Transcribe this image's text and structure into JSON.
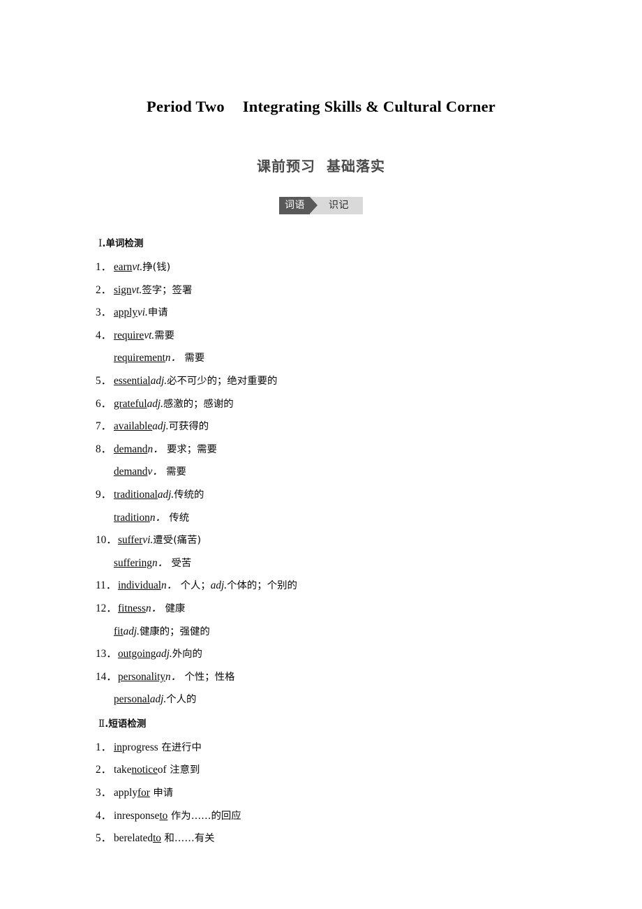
{
  "title": {
    "period": "Period Two",
    "heading": "Integrating Skills & Cultural Corner"
  },
  "subtitle": {
    "left": "课前预习",
    "right": "基础落实"
  },
  "badge": {
    "left_label": "词语",
    "right_label": "识记",
    "arrow_icon": "triangle-right-icon",
    "dark_color": "#595959",
    "light_color": "#d9d9d9"
  },
  "sections": [
    {
      "heading_roman": "Ⅰ",
      "heading_text": ".单词检测",
      "entries": [
        {
          "num": "1．",
          "word": "earn",
          "pos": "vt.",
          "meaning": "挣(钱)"
        },
        {
          "num": "2．",
          "word": "sign",
          "pos": "vt.",
          "meaning": "签字；签署"
        },
        {
          "num": "3．",
          "word": "apply",
          "pos": "vi.",
          "meaning": "申请"
        },
        {
          "num": "4．",
          "word": "require",
          "pos": "vt.",
          "meaning": "需要"
        },
        {
          "num": "",
          "word": "requirement",
          "pos": "n．",
          "meaning": " 需要",
          "sub": true
        },
        {
          "num": "5．",
          "word": "essential",
          "pos": "adj.",
          "meaning": "必不可少的；绝对重要的"
        },
        {
          "num": "6．",
          "word": "grateful",
          "pos": "adj.",
          "meaning": "感激的；感谢的"
        },
        {
          "num": "7．",
          "word": "available",
          "pos": "adj.",
          "meaning": "可获得的"
        },
        {
          "num": "8．",
          "word": "demand",
          "pos": "n．",
          "meaning": " 要求；需要"
        },
        {
          "num": "",
          "word": "demand",
          "pos": "v．",
          "meaning": " 需要",
          "sub": true
        },
        {
          "num": "9．",
          "word": "traditional",
          "pos": "adj.",
          "meaning": "传统的"
        },
        {
          "num": "",
          "word": "tradition",
          "pos": "n．",
          "meaning": " 传统",
          "sub": true
        },
        {
          "num": "10．",
          "word": "suffer",
          "pos": "vi.",
          "meaning": "遭受(痛苦)",
          "wide": true
        },
        {
          "num": "",
          "word": "suffering",
          "pos": "n．",
          "meaning": " 受苦",
          "sub": true
        },
        {
          "num": "11．",
          "word": "individual",
          "pos": "n．",
          "meaning": " 个人；",
          "pos2": "adj.",
          "meaning2": "个体的；个别的",
          "wide": true
        },
        {
          "num": "12．",
          "word": "fitness",
          "pos": "n．",
          "meaning": " 健康",
          "wide": true
        },
        {
          "num": "",
          "word": "fit",
          "pos": "adj.",
          "meaning": "健康的；强健的",
          "sub": true
        },
        {
          "num": "13．",
          "word": "outgoing",
          "pos": "adj.",
          "meaning": "外向的",
          "wide": true
        },
        {
          "num": "14．",
          "word": "personality",
          "pos": "n．",
          "meaning": " 个性；性格",
          "wide": true
        },
        {
          "num": "",
          "word": "personal",
          "pos": "adj.",
          "meaning": "个人的",
          "sub": true
        }
      ]
    },
    {
      "heading_roman": "Ⅱ",
      "heading_text": ".短语检测",
      "phrases": [
        {
          "num": "1．",
          "pre": "",
          "underlined": "in",
          "post": "progress",
          "meaning": " 在进行中"
        },
        {
          "num": "2．",
          "pre": "take",
          "underlined": "notice",
          "post": "of",
          "meaning": " 注意到"
        },
        {
          "num": "3．",
          "pre": "apply",
          "underlined": "for",
          "post": "",
          "meaning": " 申请"
        },
        {
          "num": "4．",
          "pre": "inresponse",
          "underlined": "to",
          "post": "",
          "meaning": " 作为……的回应"
        },
        {
          "num": "5．",
          "pre": "berelated",
          "underlined": "to",
          "post": "",
          "meaning": " 和……有关"
        }
      ]
    }
  ]
}
